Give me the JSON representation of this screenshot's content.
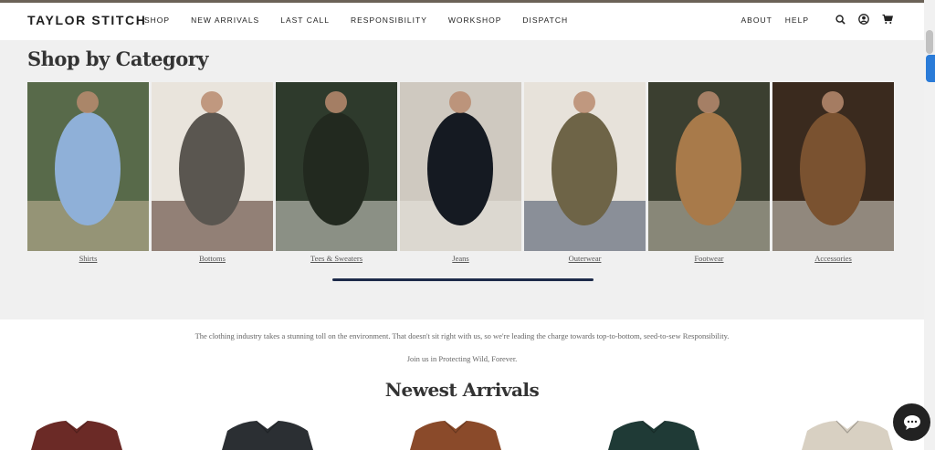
{
  "brand": {
    "logo": "TAYLOR STITCH"
  },
  "nav": {
    "items": [
      "SHOP",
      "NEW ARRIVALS",
      "LAST CALL",
      "RESPONSIBILITY",
      "WORKSHOP",
      "DISPATCH"
    ],
    "right_items": [
      "ABOUT",
      "HELP"
    ],
    "icons": [
      "search-icon",
      "account-icon",
      "cart-icon"
    ]
  },
  "categories": {
    "title": "Shop by Category",
    "items": [
      {
        "label": "Shirts",
        "colors": [
          "#586a4a",
          "#8fb0d8",
          "#c9b79a"
        ]
      },
      {
        "label": "Bottoms",
        "colors": [
          "#e9e4dc",
          "#5a5650",
          "#4a2e22"
        ]
      },
      {
        "label": "Tees & Sweaters",
        "colors": [
          "#2e3a2c",
          "#22291f",
          "#d9d7cf"
        ]
      },
      {
        "label": "Jeans",
        "colors": [
          "#cfc9c0",
          "#151a22",
          "#e7e3dd"
        ]
      },
      {
        "label": "Outerwear",
        "colors": [
          "#e7e2da",
          "#6e6447",
          "#3e4b63"
        ]
      },
      {
        "label": "Footwear",
        "colors": [
          "#3b3f30",
          "#a87a4a",
          "#c9c2b4"
        ]
      },
      {
        "label": "Accessories",
        "colors": [
          "#3a2a1e",
          "#7a5230",
          "#d9d5cc"
        ]
      }
    ]
  },
  "responsibility": {
    "text": "The clothing industry takes a stunning toll on the environment. That doesn't sit right with us, so we're leading the charge towards top-to-bottom, seed-to-sew Responsibility.",
    "cta": "Join us in Protecting Wild, Forever."
  },
  "newest": {
    "title": "Newest Arrivals",
    "product_colors": [
      "#6b2a26",
      "#2b2f33",
      "#8a4a2a",
      "#1f3a36",
      "#d8d0c2"
    ]
  }
}
